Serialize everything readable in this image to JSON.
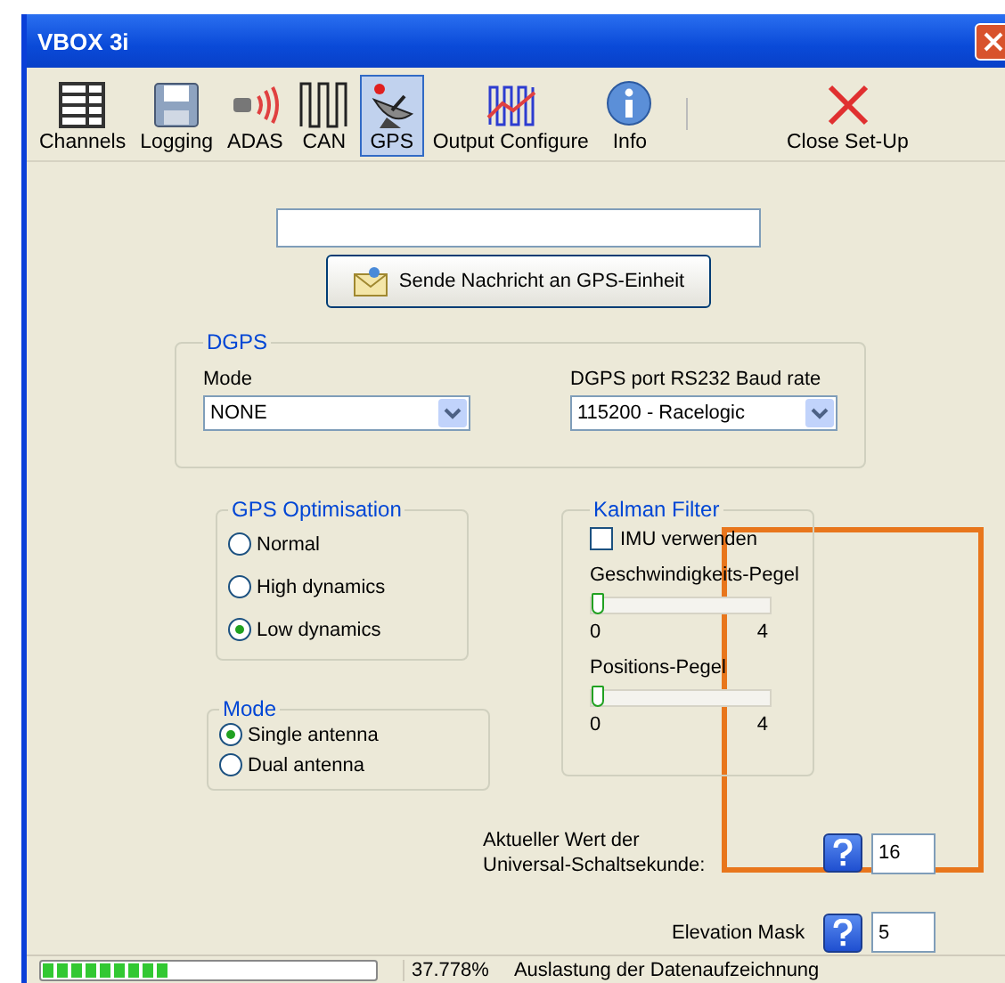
{
  "window": {
    "title": "VBOX 3i"
  },
  "toolbar": [
    {
      "label": "Channels",
      "kind": "grid",
      "selected": false
    },
    {
      "label": "Logging",
      "kind": "disk",
      "selected": false
    },
    {
      "label": "ADAS",
      "kind": "radar",
      "selected": false
    },
    {
      "label": "CAN",
      "kind": "wave",
      "selected": false
    },
    {
      "label": "GPS",
      "kind": "dish",
      "selected": true
    },
    {
      "label": "Output Configure",
      "kind": "signal",
      "selected": false
    },
    {
      "label": "Info",
      "kind": "info",
      "selected": false
    },
    {
      "label": "Close Set-Up",
      "kind": "close",
      "selected": false
    }
  ],
  "send_button": "Sende Nachricht an GPS-Einheit",
  "dgps": {
    "title": "DGPS",
    "mode": {
      "label": "Mode",
      "value": "NONE"
    },
    "baud": {
      "label": "DGPS port RS232 Baud rate",
      "value": "115200 - Racelogic"
    }
  },
  "gps_optimisation": {
    "title": "GPS Optimisation",
    "options": [
      {
        "label": "Normal",
        "selected": false
      },
      {
        "label": "High dynamics",
        "selected": false
      },
      {
        "label": "Low dynamics",
        "selected": true
      }
    ]
  },
  "antenna_mode": {
    "title": "Mode",
    "options": [
      {
        "label": "Single antenna",
        "selected": true
      },
      {
        "label": "Dual antenna",
        "selected": false
      }
    ]
  },
  "kalman": {
    "title": "Kalman Filter",
    "imu": {
      "label": "IMU verwenden",
      "checked": false
    },
    "sliders": [
      {
        "label": "Geschwindigkeits-Pegel",
        "level": 0,
        "min": "0",
        "max": "4"
      },
      {
        "label": "Positions-Pegel",
        "level": 0,
        "min": "0",
        "max": "4"
      }
    ]
  },
  "leap_second": {
    "label": "Aktueller Wert der Universal-Schaltsekunde:",
    "value": "16"
  },
  "elevation_mask": {
    "label": "Elevation Mask",
    "value": "5"
  },
  "status_bar": {
    "level": 0.378,
    "percent": "37.778%",
    "text": "Auslastung der Datenaufzeichnung"
  }
}
